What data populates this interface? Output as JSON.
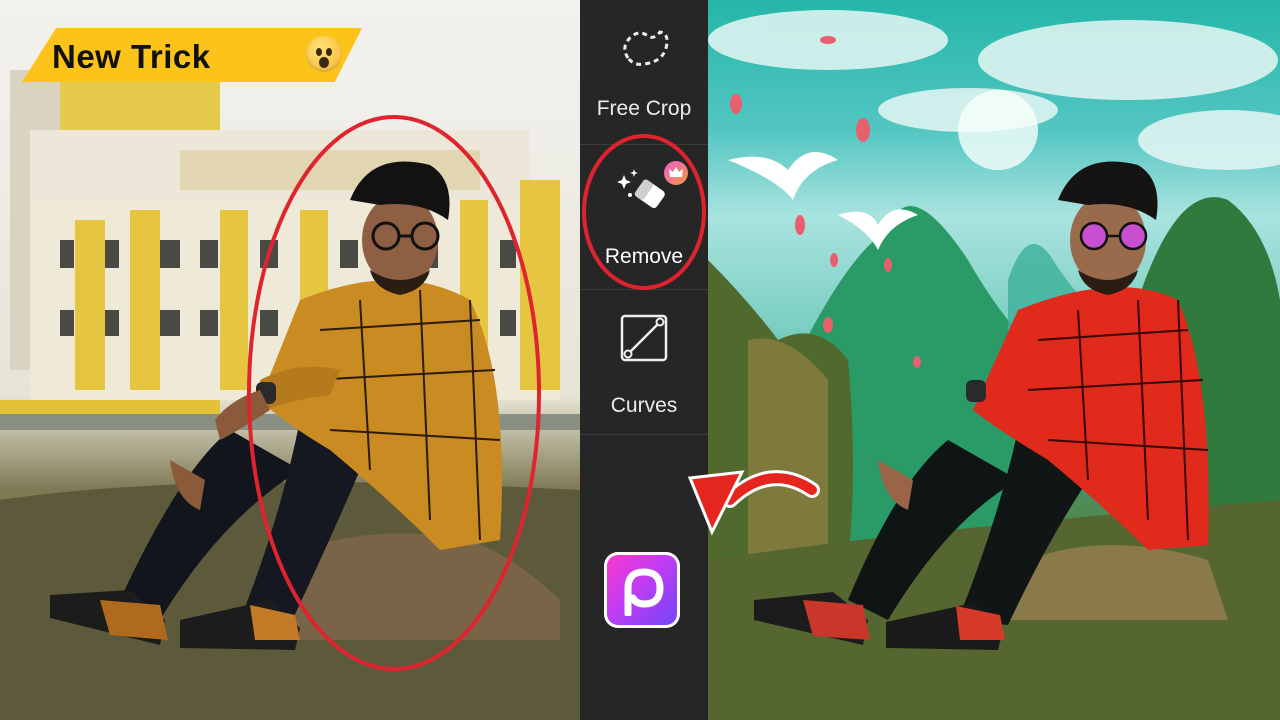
{
  "badge": {
    "text": "New Trick",
    "emoji": "astonished-face"
  },
  "toolbar": {
    "tools": [
      {
        "label": "Free Crop",
        "icon": "free-crop-icon"
      },
      {
        "label": "Remove",
        "icon": "magic-eraser-icon",
        "premium": true
      },
      {
        "label": "Curves",
        "icon": "curves-icon"
      }
    ],
    "app_logo": "picsart-logo"
  },
  "colors": {
    "badge": "#fcc31a",
    "highlight": "#e0242f",
    "toolbar_bg": "#262626",
    "logo_gradient_start": "#ff37c9",
    "logo_gradient_end": "#6a48f7"
  }
}
